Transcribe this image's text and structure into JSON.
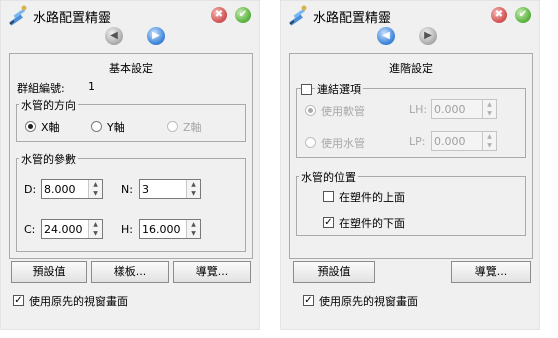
{
  "left": {
    "title": "水路配置精靈",
    "app_icon": "pipe-wizard-icon",
    "section_title": "基本設定",
    "group_number": {
      "label": "群組編號:",
      "value": "1"
    },
    "direction": {
      "title": "水管的方向",
      "options": [
        "X軸",
        "Y軸",
        "Z軸"
      ],
      "selected": "X軸"
    },
    "params": {
      "title": "水管的參數",
      "fields": [
        {
          "label": "D:",
          "value": "8.000"
        },
        {
          "label": "N:",
          "value": "3"
        },
        {
          "label": "C:",
          "value": "24.000"
        },
        {
          "label": "H:",
          "value": "16.000"
        }
      ]
    },
    "buttons": {
      "default": "預設值",
      "template": "樣板...",
      "browse": "導覽..."
    },
    "use_prev_view": {
      "label": "使用原先的視窗畫面",
      "checked": true
    }
  },
  "right": {
    "title": "水路配置精靈",
    "app_icon": "pipe-wizard-icon",
    "section_title": "進階設定",
    "link": {
      "label": "連結選項",
      "checked": false,
      "use_slot": {
        "label": "使用軟管",
        "field_label": "LH:",
        "value": "0.000"
      },
      "use_pipe": {
        "label": "使用水管",
        "field_label": "LP:",
        "value": "0.000"
      }
    },
    "position": {
      "title": "水管的位置",
      "above": {
        "label": "在塑件的上面",
        "checked": false
      },
      "below": {
        "label": "在塑件的下面",
        "checked": true
      }
    },
    "buttons": {
      "default": "預設值",
      "browse": "導覽..."
    },
    "use_prev_view": {
      "label": "使用原先的視窗畫面",
      "checked": true
    }
  },
  "icons": {
    "close": "close-icon",
    "ok": "check-icon",
    "back": "back-arrow-icon",
    "forward": "forward-arrow-icon"
  },
  "glyphs": {
    "cross": "✖",
    "tick": "✔",
    "left_arrow": "◀",
    "right_arrow": "▶",
    "check_mark": "✓",
    "spin_up": "▲",
    "spin_down": "▼"
  }
}
